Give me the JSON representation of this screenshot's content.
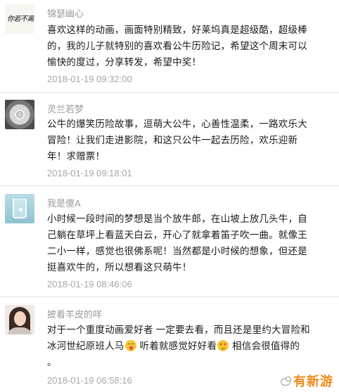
{
  "comments": [
    {
      "username": "锦瑟幽心",
      "avatar_text": "你若不离不弃",
      "lines": [
        "喜欢这样的动画，画面特别精致，好莱坞真是超级酷，超级棒",
        "的，我的儿子就特别的喜欢看公牛历险记，希望这个周末可以",
        "愉快的度过，分享转发，希望中奖！"
      ],
      "timestamp": "2018-01-19 09:32:00"
    },
    {
      "username": "灵兰若梦",
      "lines": [
        "公牛的爆笑历险故事，逗萌大公牛，心善性温柔，一路欢乐大",
        "冒险！让我们走进影院，和这只公牛一起去历险，欢乐迎新",
        "年！求赠票！"
      ],
      "timestamp": "2018-01-19 09:18:01"
    },
    {
      "username": "我是傻A",
      "lines": [
        "小时候一段时间的梦想是当个放牛郎，在山坡上放几头牛，自",
        "己躺在草坪上看蓝天白云，开心了就拿着笛子吹一曲。就像王",
        "二小一样，感觉也很佛系呢！当然都是小时候的想象，但还是",
        "挺喜欢牛的，所以想看这只萌牛！"
      ],
      "timestamp": "2018-01-19 08:46:06"
    },
    {
      "username": "披着羊皮的咩",
      "line1": "对于一个重度动画爱好者 一定要去看，而且还是里约大冒险和",
      "line2_a": "冰河世纪原班人马",
      "line2_b": " 听着就感觉好好看",
      "line2_c": " 相信会很值得的",
      "line3": "。",
      "timestamp": "2018-01-19 06:58:16"
    }
  ],
  "icons": {
    "emoji_1": "tongue-out-emoji",
    "emoji_2": "heart-eyes-emoji",
    "watermark_logo": "bird-logo-icon"
  },
  "watermark": {
    "text": "有新游",
    "color": "#f08a1a"
  }
}
